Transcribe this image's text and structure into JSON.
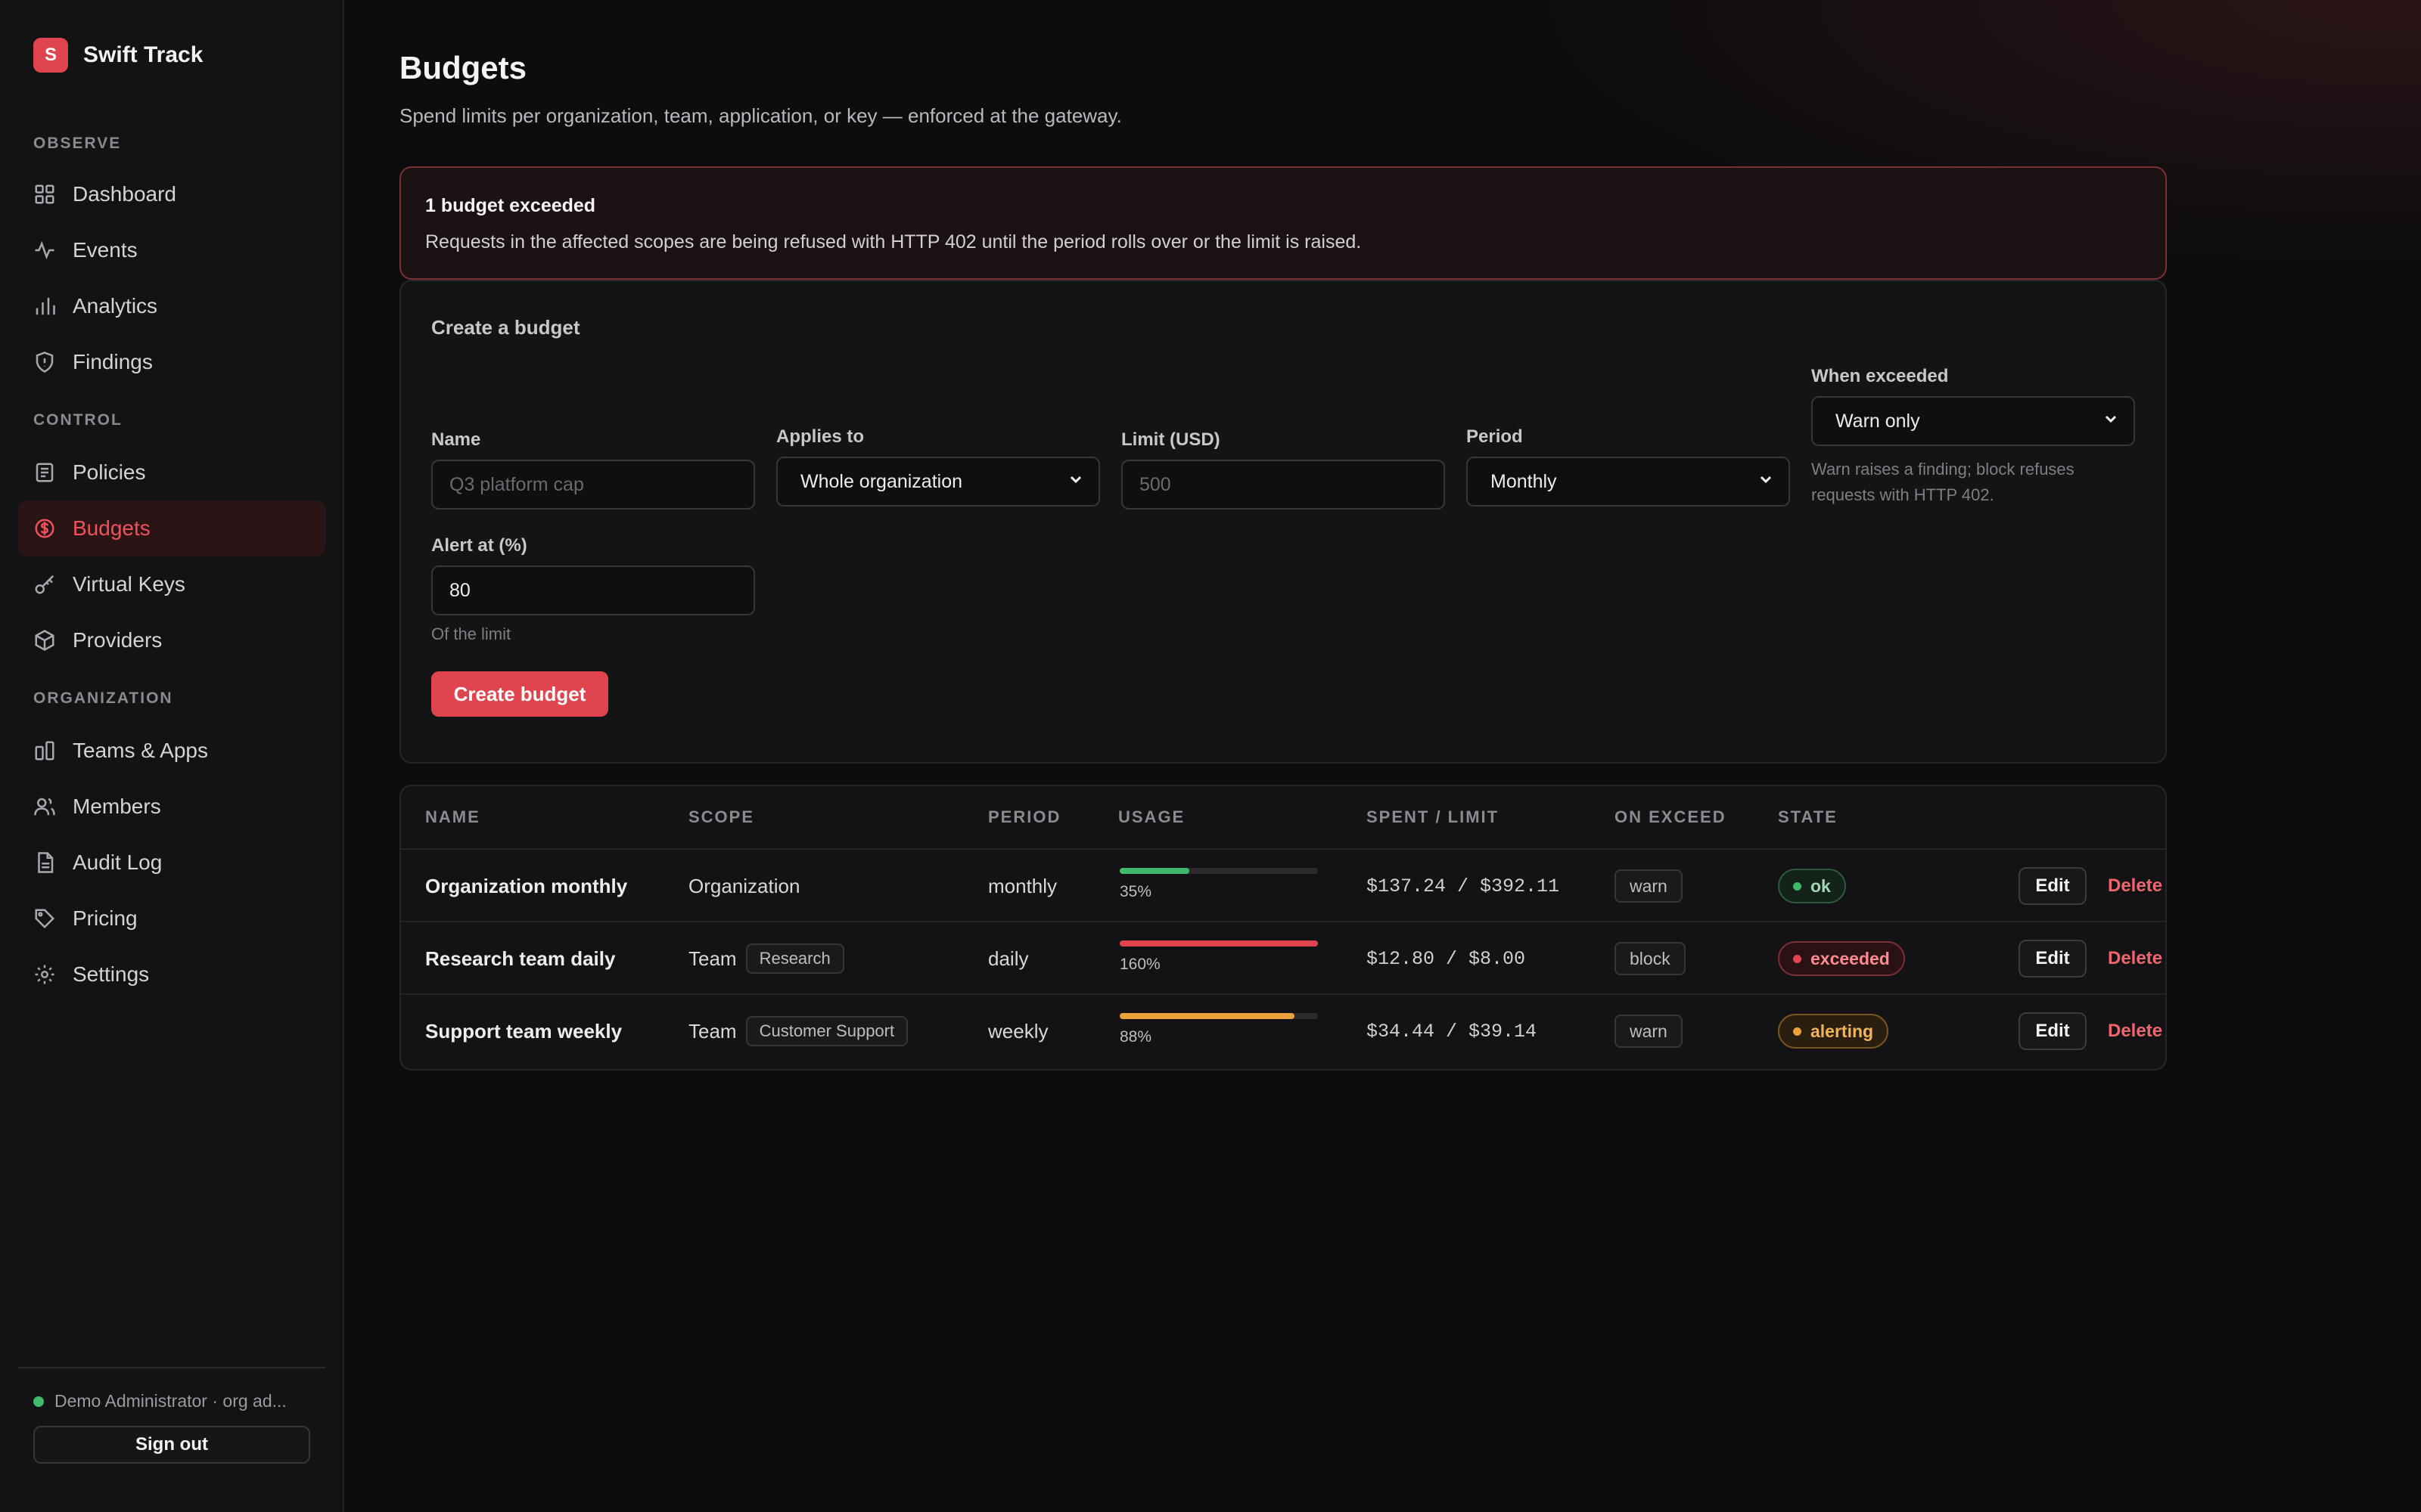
{
  "app": {
    "name": "Swift Track",
    "logo_letter": "S"
  },
  "colors": {
    "accent": "#e0454f",
    "ok": "#3fb96a",
    "exceeded": "#e0454f",
    "alerting": "#e9a23b"
  },
  "sidebar": {
    "sections": [
      {
        "label": "OBSERVE",
        "items": [
          {
            "label": "Dashboard",
            "icon": "grid-icon"
          },
          {
            "label": "Events",
            "icon": "activity-icon"
          },
          {
            "label": "Analytics",
            "icon": "bar-chart-icon"
          },
          {
            "label": "Findings",
            "icon": "shield-icon"
          }
        ]
      },
      {
        "label": "CONTROL",
        "items": [
          {
            "label": "Policies",
            "icon": "document-icon"
          },
          {
            "label": "Budgets",
            "icon": "dollar-circle-icon",
            "active": true
          },
          {
            "label": "Virtual Keys",
            "icon": "key-icon"
          },
          {
            "label": "Providers",
            "icon": "cube-icon"
          }
        ]
      },
      {
        "label": "ORGANIZATION",
        "items": [
          {
            "label": "Teams & Apps",
            "icon": "columns-icon"
          },
          {
            "label": "Members",
            "icon": "users-icon"
          },
          {
            "label": "Audit Log",
            "icon": "file-icon"
          },
          {
            "label": "Pricing",
            "icon": "tag-icon"
          },
          {
            "label": "Settings",
            "icon": "gear-icon"
          }
        ]
      }
    ],
    "user": "Demo Administrator · org ad...",
    "sign_out": "Sign out"
  },
  "page": {
    "title": "Budgets",
    "subtitle": "Spend limits per organization, team, application, or key — enforced at the gateway."
  },
  "alert": {
    "title": "1 budget exceeded",
    "text": "Requests in the affected scopes are being refused with HTTP 402 until the period rolls over or the limit is raised."
  },
  "form": {
    "title": "Create a budget",
    "name_label": "Name",
    "name_placeholder": "Q3 platform cap",
    "applies_label": "Applies to",
    "applies_value": "Whole organization",
    "limit_label": "Limit (USD)",
    "limit_placeholder": "500",
    "period_label": "Period",
    "period_value": "Monthly",
    "exceed_label": "When exceeded",
    "exceed_value": "Warn only",
    "exceed_hint_1": "Warn raises a finding; block refuses",
    "exceed_hint_2": "requests with HTTP 402.",
    "alert_label": "Alert at (%)",
    "alert_value": "80",
    "alert_hint": "Of the limit",
    "submit": "Create budget"
  },
  "table": {
    "headers": [
      "NAME",
      "SCOPE",
      "PERIOD",
      "USAGE",
      "SPENT / LIMIT",
      "ON EXCEED",
      "STATE"
    ],
    "rows": [
      {
        "name": "Organization monthly",
        "scope": "Organization",
        "scope_chip": "",
        "period": "monthly",
        "usage": 0.35,
        "usage_label": "35%",
        "spent": "$137.24 / $392.11",
        "on_exceed": "warn",
        "state": "ok",
        "edit": "Edit",
        "delete": "Delete"
      },
      {
        "name": "Research team daily",
        "scope": "Team",
        "scope_chip": "Research",
        "period": "daily",
        "usage": 1.6,
        "usage_label": "160%",
        "spent": "$12.80 / $8.00",
        "on_exceed": "block",
        "state": "exceeded",
        "edit": "Edit",
        "delete": "Delete"
      },
      {
        "name": "Support team weekly",
        "scope": "Team",
        "scope_chip": "Customer Support",
        "period": "weekly",
        "usage": 0.88,
        "usage_label": "88%",
        "spent": "$34.44 / $39.14",
        "on_exceed": "warn",
        "state": "alerting",
        "edit": "Edit",
        "delete": "Delete"
      }
    ]
  }
}
